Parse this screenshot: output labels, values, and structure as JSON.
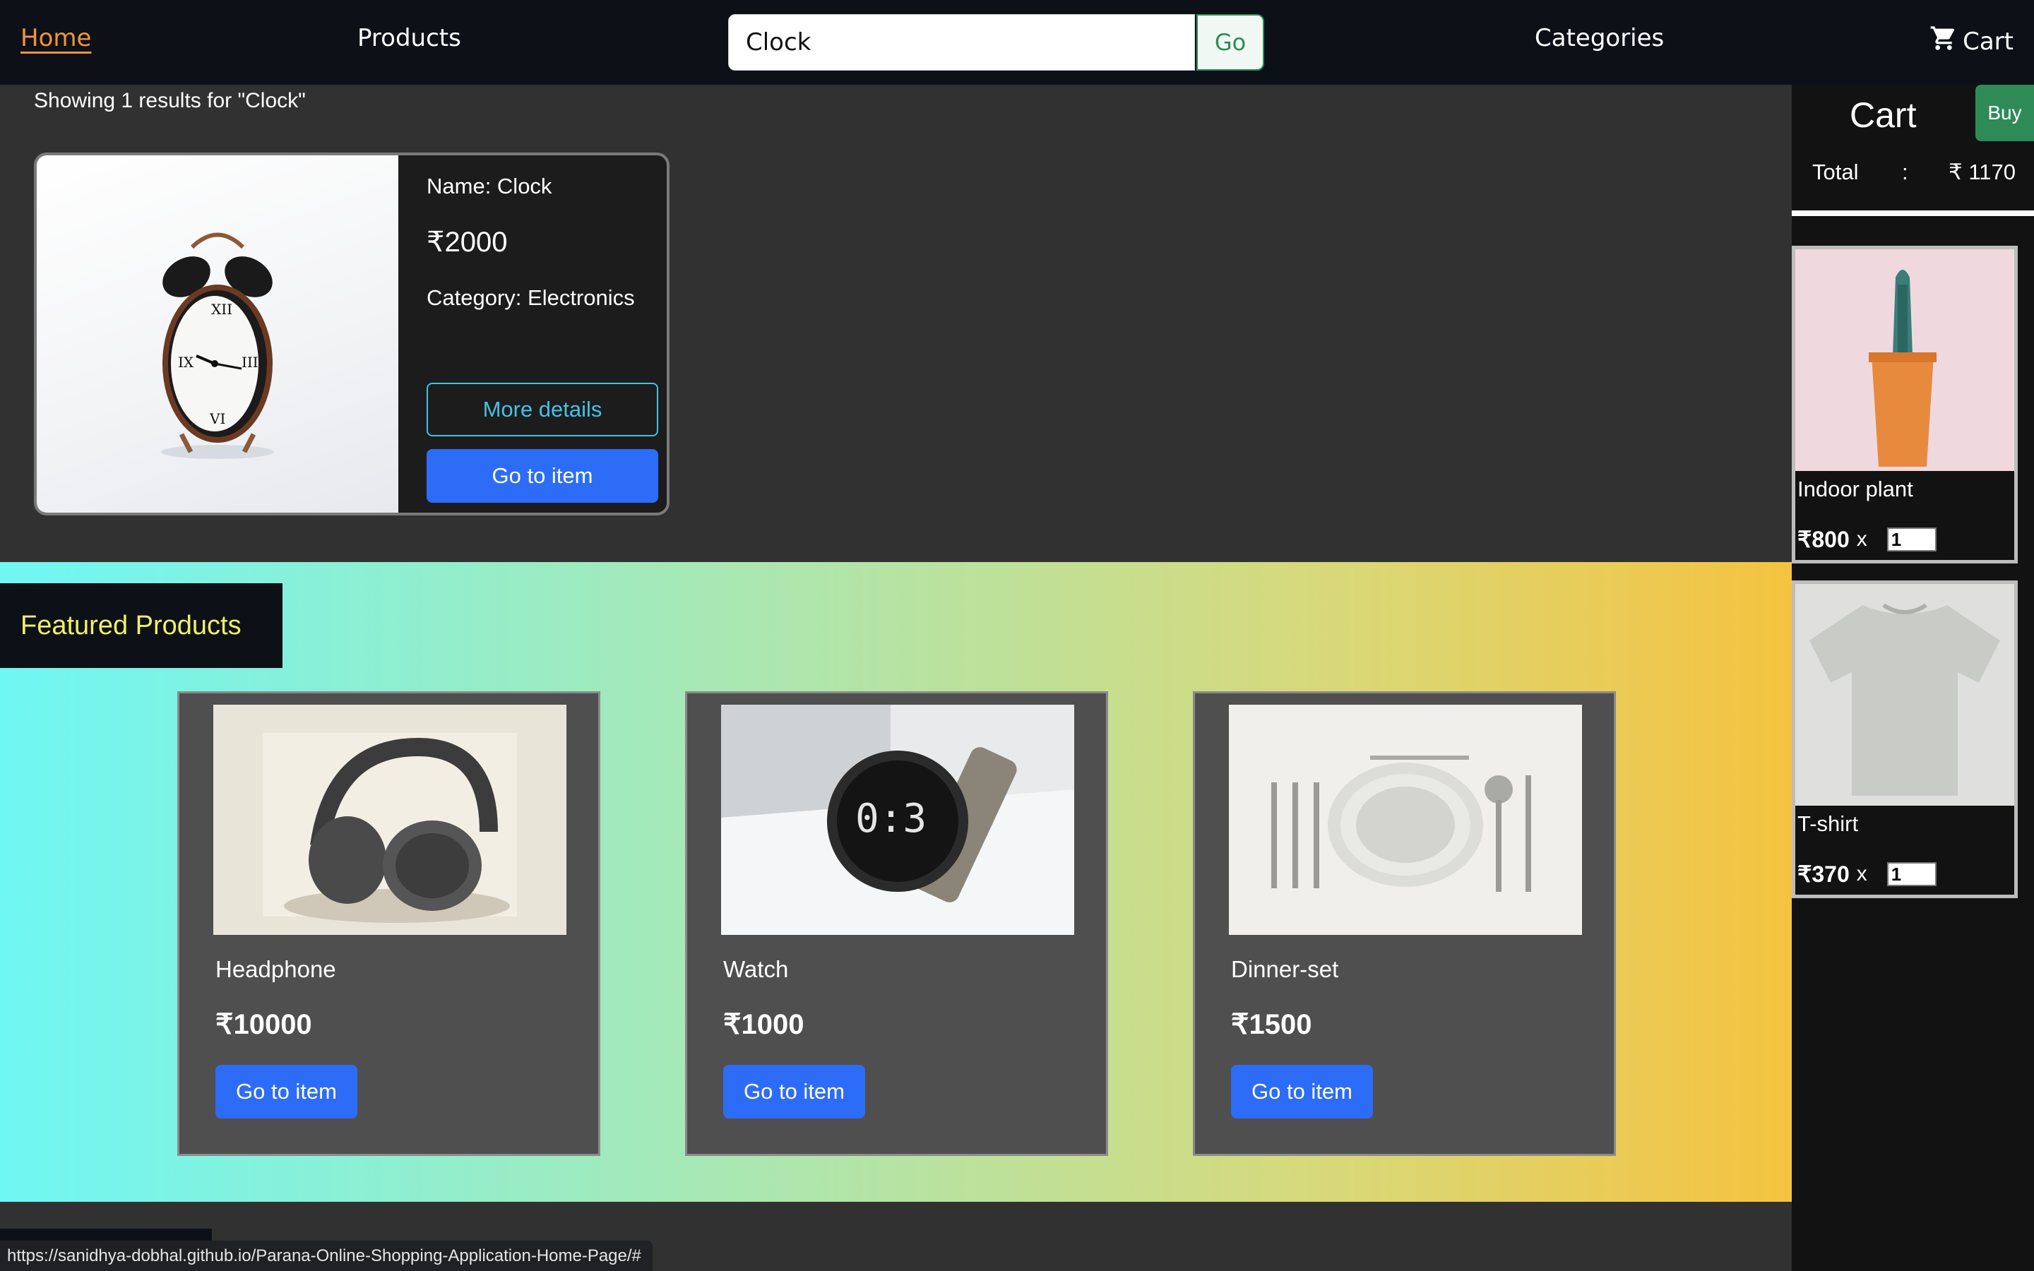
{
  "nav": {
    "home": "Home",
    "products": "Products",
    "search_value": "Clock",
    "search_button": "Go",
    "categories": "Categories",
    "cart": "Cart"
  },
  "results": {
    "summary": "Showing 1 results for \"Clock\"",
    "item": {
      "name": "Name: Clock",
      "price": "₹2000",
      "category": "Category: Electronics",
      "more_details": "More details",
      "goto": "Go to item"
    }
  },
  "featured": {
    "title": "Featured Products",
    "items": [
      {
        "name": "Headphone",
        "price": "₹10000",
        "button": "Go to item"
      },
      {
        "name": "Watch",
        "price": "₹1000",
        "button": "Go to item"
      },
      {
        "name": "Dinner-set",
        "price": "₹1500",
        "button": "Go to item"
      }
    ]
  },
  "cart": {
    "title": "Cart",
    "buy": "Buy",
    "total_label": "Total",
    "colon": ":",
    "total_value": "₹ 1170",
    "items": [
      {
        "name": "Indoor plant",
        "price": "₹800",
        "x": "x",
        "qty": "1"
      },
      {
        "name": "T-shirt",
        "price": "₹370",
        "x": "x",
        "qty": "1"
      }
    ]
  },
  "status_url": "https://sanidhya-dobhal.github.io/Parana-Online-Shopping-Application-Home-Page/#",
  "colors": {
    "navbar": "#0d1117",
    "accent_home": "#f0943c",
    "primary_button": "#2d6cf6",
    "info_button": "#45c1e6",
    "success": "#2e8b57",
    "featured_title": "#eef06a"
  },
  "icons": {
    "cart": "shopping-cart-icon"
  }
}
